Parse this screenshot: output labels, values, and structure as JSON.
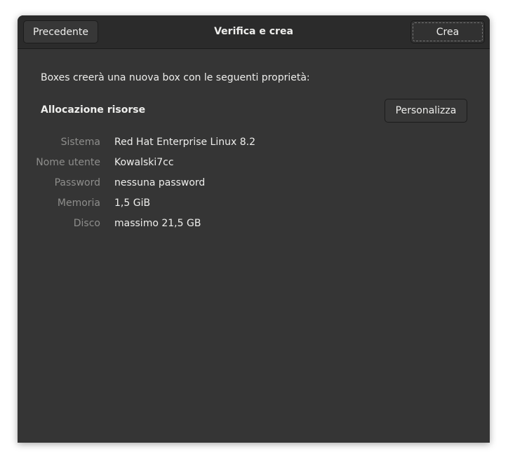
{
  "header": {
    "back_label": "Precedente",
    "title": "Verifica e crea",
    "create_label": "Crea"
  },
  "body": {
    "intro": "Boxes creerà una nuova box con le seguenti proprietà:",
    "section_title": "Allocazione risorse",
    "customize_label": "Personalizza",
    "properties": [
      {
        "label": "Sistema",
        "value": "Red Hat Enterprise Linux 8.2"
      },
      {
        "label": "Nome utente",
        "value": "Kowalski7cc"
      },
      {
        "label": "Password",
        "value": "nessuna password"
      },
      {
        "label": "Memoria",
        "value": "1,5 GiB"
      },
      {
        "label": "Disco",
        "value": "massimo 21,5 GB"
      }
    ]
  }
}
